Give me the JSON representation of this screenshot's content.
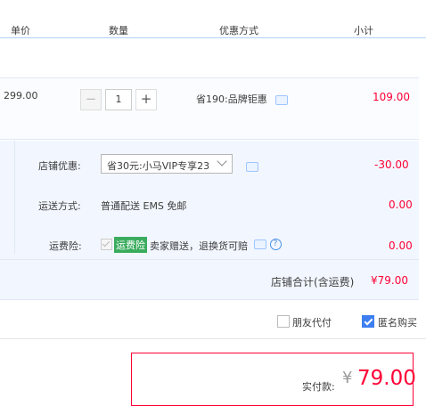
{
  "header": {
    "col_price": "单价",
    "col_qty": "数量",
    "col_promo": "优惠方式",
    "col_subtotal": "小计"
  },
  "item": {
    "unit_price": "299.00",
    "minus": "−",
    "quantity": "1",
    "plus": "+",
    "promotion": "省190:品牌钜惠",
    "subtotal": "109.00"
  },
  "shop": {
    "coupon_label": "店铺优惠:",
    "coupon_selected": "省30元:小马VIP专享23",
    "coupon_amount": "-30.00",
    "shipping_label": "运送方式:",
    "shipping_value": "普通配送 EMS 免邮",
    "shipping_amount": "0.00",
    "insurance_label": "运费险:",
    "insurance_tag": "运费险",
    "insurance_desc": "卖家赠送，退换货可赔",
    "insurance_help": "?",
    "insurance_amount": "0.00",
    "total_label": "店铺合计(含运费)",
    "total_value": "¥79.00"
  },
  "options": {
    "friend_pay": "朋友代付",
    "friend_pay_checked": false,
    "anonymous": "匿名购买",
    "anonymous_checked": true
  },
  "payment": {
    "label": "实付款:",
    "currency": "¥",
    "amount": "79.00"
  },
  "colors": {
    "price_red": "#ff0036",
    "header_line": "#b2d1ff",
    "summary_bg": "#f2f7ff",
    "insurance_green": "#3aac5d",
    "checkbox_blue": "#3d7ef0"
  }
}
